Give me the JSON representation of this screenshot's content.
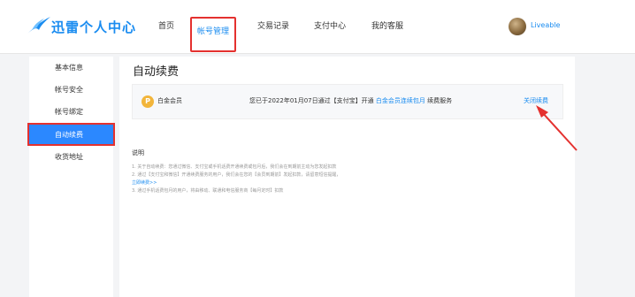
{
  "brand": {
    "name": "迅雷个人中心",
    "color": "#1a8cf0"
  },
  "nav": {
    "items": [
      {
        "label": "首页"
      },
      {
        "label": "帐号管理",
        "active": true
      },
      {
        "label": "交易记录"
      },
      {
        "label": "支付中心"
      },
      {
        "label": "我的客服"
      }
    ]
  },
  "user": {
    "name": "Liveable",
    "avatar_icon": "avatar-icon"
  },
  "sidebar": {
    "items": [
      {
        "label": "基本信息"
      },
      {
        "label": "帐号安全"
      },
      {
        "label": "帐号绑定"
      },
      {
        "label": "自动续费",
        "active": true
      },
      {
        "label": "收货地址"
      }
    ],
    "active_color": "#2b88ff"
  },
  "main": {
    "title": "自动续费",
    "subscription": {
      "icon": "platinum-member-icon",
      "name": "白金会员",
      "info_prefix": "您已于2022年01月07日通过【支付宝】开通",
      "info_link": "白金会员连续包月",
      "info_suffix": "续费服务",
      "close_label": "关闭续费"
    },
    "notes": {
      "title": "说明",
      "lines": [
        "1. 关于自动续费：您通过微信、支付宝或手机话费开通续费或包月后，我们会在到期前主动为您发起扣款",
        "2. 通过【支付宝和微信】开通续费服务的用户，我们会在您的【会员到期前】发起扣款，请留意短信提醒，",
        "3. 通过手机话费包月的用户，将由移动、联通和电信服务商【每月定时】扣款"
      ],
      "link": "立即续费>>"
    }
  },
  "colors": {
    "highlight": "#e4312f",
    "link": "#1a8cf0"
  }
}
